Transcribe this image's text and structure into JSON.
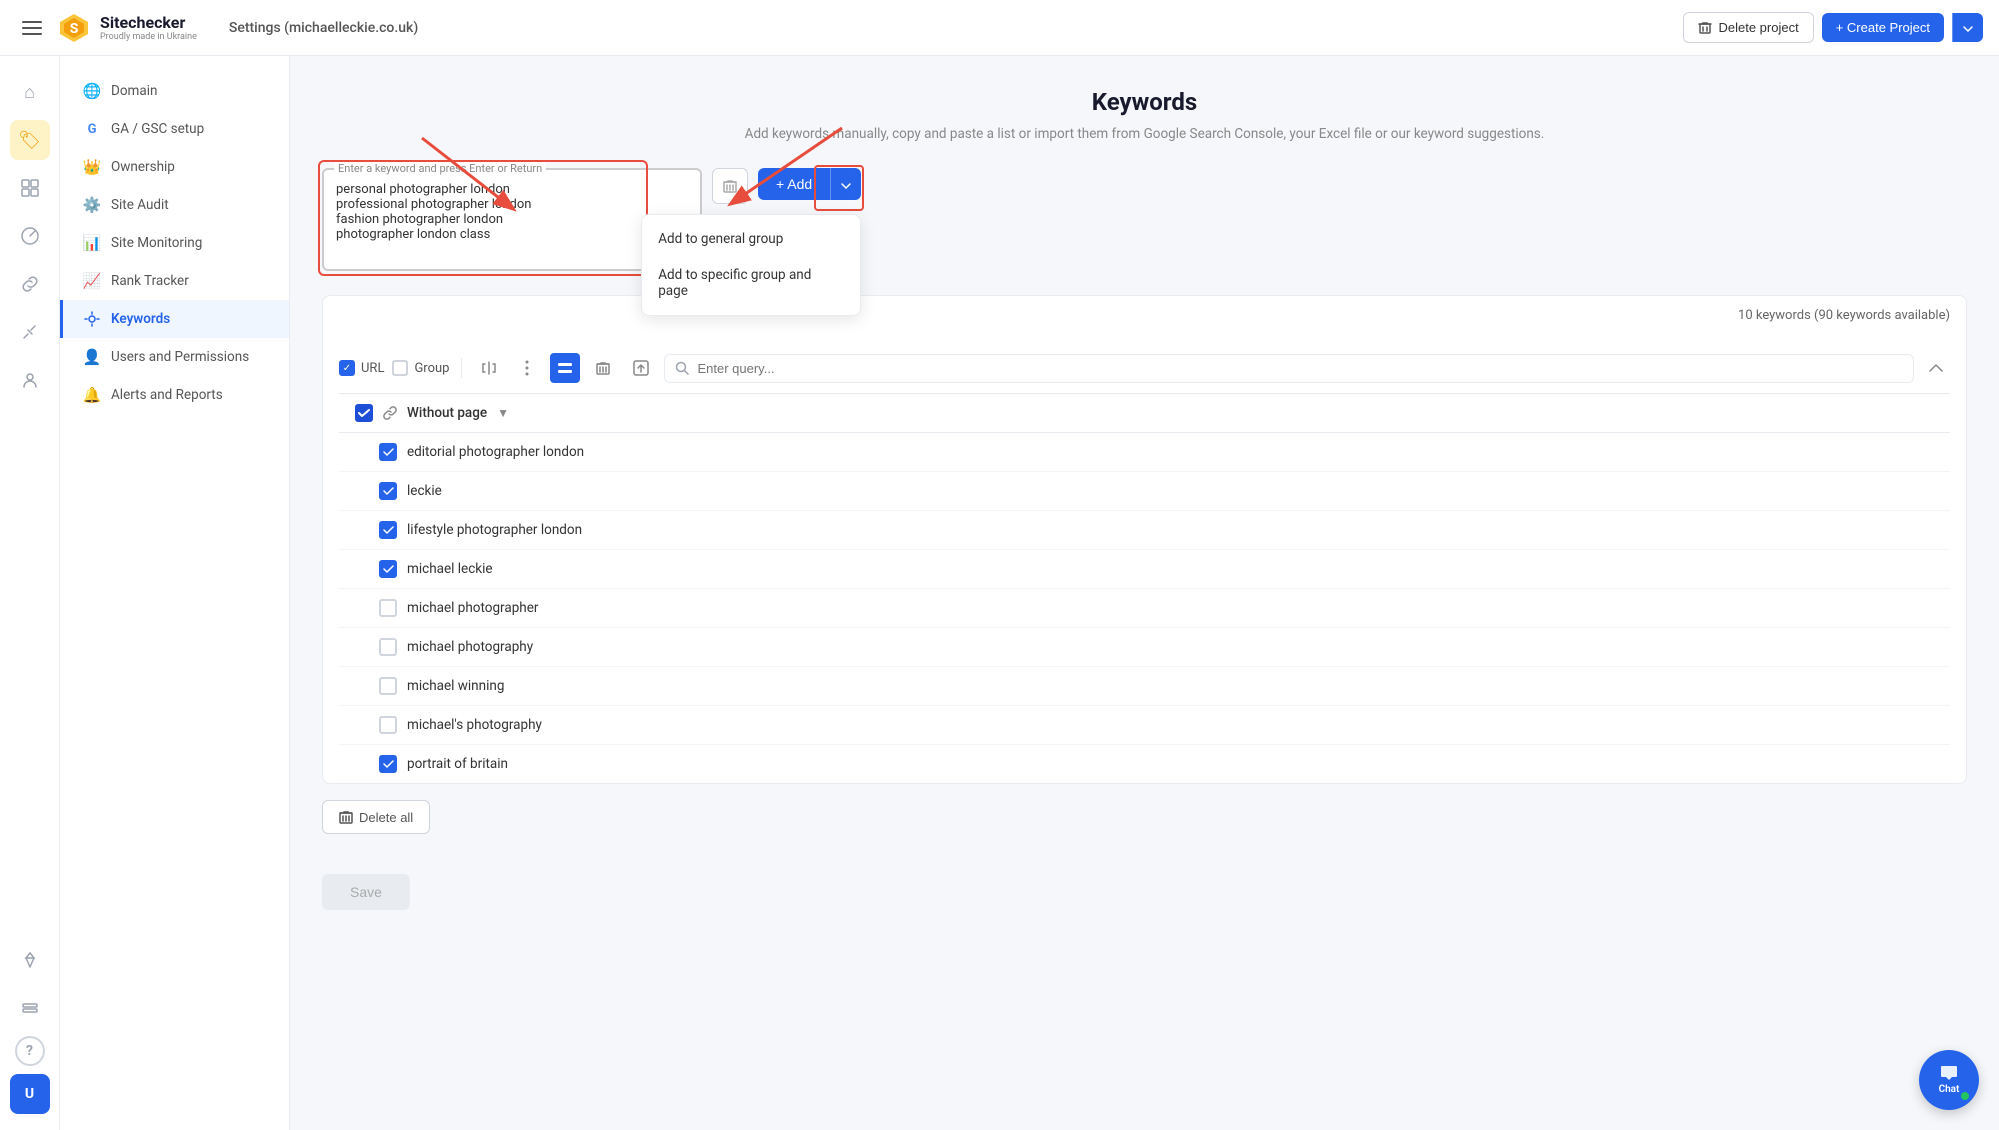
{
  "app": {
    "name": "Sitechecker",
    "tagline": "Proudly made in Ukraine",
    "settings_title": "Settings (michaelleckie.co.uk)"
  },
  "topnav": {
    "delete_project_label": "Delete project",
    "create_project_label": "+ Create Project"
  },
  "sidebar": {
    "items": [
      {
        "id": "domain",
        "label": "Domain",
        "icon": "🌐"
      },
      {
        "id": "ga-gsc",
        "label": "GA / GSC setup",
        "icon": "G"
      },
      {
        "id": "ownership",
        "label": "Ownership",
        "icon": "👑"
      },
      {
        "id": "site-audit",
        "label": "Site Audit",
        "icon": "⚙️"
      },
      {
        "id": "site-monitoring",
        "label": "Site Monitoring",
        "icon": "📊"
      },
      {
        "id": "rank-tracker",
        "label": "Rank Tracker",
        "icon": "📈"
      },
      {
        "id": "keywords",
        "label": "Keywords",
        "icon": "🔑",
        "active": true
      },
      {
        "id": "users-permissions",
        "label": "Users and Permissions",
        "icon": "👤"
      },
      {
        "id": "alerts-reports",
        "label": "Alerts and Reports",
        "icon": "🔔"
      }
    ]
  },
  "keywords": {
    "title": "Keywords",
    "description": "Add keywords manually, copy and paste a list or import them from Google Search Console, your Excel file or our keyword suggestions.",
    "input": {
      "label": "Enter a keyword and press Enter or Return",
      "value": "personal photographer london\nprofessional photographer london\nfashion photographer london\nphotographer london class",
      "placeholder": "Enter a keyword and press Enter or Return"
    },
    "add_button_label": "+ Add",
    "dropdown_items": [
      {
        "id": "add-to-general",
        "label": "Add to general group"
      },
      {
        "id": "add-to-specific",
        "label": "Add to specific group and page"
      }
    ],
    "keywords_count": "10 keywords (90 keywords available)",
    "search_placeholder": "Enter query...",
    "group_label": "Without page",
    "table_rows": [
      {
        "id": 1,
        "label": "editorial photographer london",
        "checked": true
      },
      {
        "id": 2,
        "label": "leckie",
        "checked": true
      },
      {
        "id": 3,
        "label": "lifestyle photographer london",
        "checked": true
      },
      {
        "id": 4,
        "label": "michael leckie",
        "checked": true
      },
      {
        "id": 5,
        "label": "michael photographer",
        "checked": false
      },
      {
        "id": 6,
        "label": "michael photography",
        "checked": false
      },
      {
        "id": 7,
        "label": "michael winning",
        "checked": false
      },
      {
        "id": 8,
        "label": "michael's photography",
        "checked": false
      },
      {
        "id": 9,
        "label": "portrait of britain",
        "checked": true
      }
    ],
    "delete_all_label": "Delete all",
    "save_label": "Save",
    "controls": {
      "url_label": "URL",
      "group_label": "Group"
    }
  },
  "chat": {
    "label": "Chat",
    "online_dot": "green"
  },
  "left_nav_icons": [
    {
      "id": "home",
      "icon": "⌂",
      "active": false
    },
    {
      "id": "dashboard",
      "icon": "▦",
      "active": false,
      "yellow": true
    },
    {
      "id": "grid",
      "icon": "⊞",
      "active": false
    },
    {
      "id": "analytics",
      "icon": "◕",
      "active": false
    },
    {
      "id": "links",
      "icon": "🔗",
      "active": false
    },
    {
      "id": "tools",
      "icon": "✏️",
      "active": false
    },
    {
      "id": "users",
      "icon": "👥",
      "active": false
    },
    {
      "id": "diamond",
      "icon": "◇",
      "active": false
    },
    {
      "id": "layers",
      "icon": "⊟",
      "active": false
    },
    {
      "id": "help",
      "icon": "?",
      "active": false
    }
  ]
}
